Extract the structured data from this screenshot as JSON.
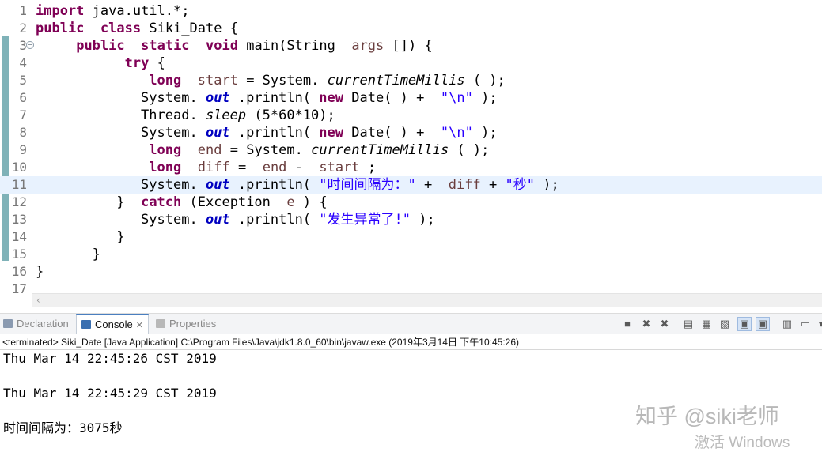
{
  "editor": {
    "current_line": "11",
    "lines": [
      {
        "n": "1",
        "tokens": [
          [
            "kw",
            "import"
          ],
          [
            "",
            "java.util.*;"
          ]
        ]
      },
      {
        "n": "2",
        "tokens": [
          [
            "kw",
            "public"
          ],
          [
            "",
            ""
          ],
          [
            "kw",
            "class"
          ],
          [
            "",
            "Siki_Date {"
          ]
        ]
      },
      {
        "n": "3",
        "fold": "−",
        "tokens": [
          [
            "",
            "    "
          ],
          [
            "kw",
            "public"
          ],
          [
            "",
            ""
          ],
          [
            "kw",
            "static"
          ],
          [
            "",
            ""
          ],
          [
            "kw",
            "void"
          ],
          [
            "",
            "main(String "
          ],
          [
            "var",
            "args"
          ],
          [
            "",
            "[]) {"
          ]
        ]
      },
      {
        "n": "4",
        "tokens": [
          [
            "",
            "          "
          ],
          [
            "kw",
            "try"
          ],
          [
            "",
            "{"
          ]
        ]
      },
      {
        "n": "5",
        "tokens": [
          [
            "",
            "             "
          ],
          [
            "kw",
            "long"
          ],
          [
            "",
            ""
          ],
          [
            "var",
            "start"
          ],
          [
            "",
            "= System."
          ],
          [
            "st",
            "currentTimeMillis"
          ],
          [
            "",
            "( );"
          ]
        ]
      },
      {
        "n": "6",
        "tokens": [
          [
            "",
            "             System."
          ],
          [
            "fld",
            "out"
          ],
          [
            "",
            ".println("
          ],
          [
            "kw",
            "new"
          ],
          [
            "",
            "Date( ) + "
          ],
          [
            "str",
            "\"\\n\""
          ],
          [
            "",
            ");"
          ]
        ]
      },
      {
        "n": "7",
        "tokens": [
          [
            "",
            "             Thread."
          ],
          [
            "st",
            "sleep"
          ],
          [
            "",
            "(5*60*10);"
          ]
        ]
      },
      {
        "n": "8",
        "tokens": [
          [
            "",
            "             System."
          ],
          [
            "fld",
            "out"
          ],
          [
            "",
            ".println("
          ],
          [
            "kw",
            "new"
          ],
          [
            "",
            "Date( ) + "
          ],
          [
            "str",
            "\"\\n\""
          ],
          [
            "",
            ");"
          ]
        ]
      },
      {
        "n": "9",
        "tokens": [
          [
            "",
            "             "
          ],
          [
            "kw",
            "long"
          ],
          [
            "",
            ""
          ],
          [
            "var",
            "end"
          ],
          [
            "",
            "= System."
          ],
          [
            "st",
            "currentTimeMillis"
          ],
          [
            "",
            "( );"
          ]
        ]
      },
      {
        "n": "10",
        "tokens": [
          [
            "",
            "             "
          ],
          [
            "kw",
            "long"
          ],
          [
            "",
            ""
          ],
          [
            "var",
            "diff"
          ],
          [
            "",
            "= "
          ],
          [
            "var",
            "end"
          ],
          [
            "",
            "- "
          ],
          [
            "var",
            "start"
          ],
          [
            "",
            ";"
          ]
        ]
      },
      {
        "n": "11",
        "tokens": [
          [
            "",
            "             System."
          ],
          [
            "fld",
            "out"
          ],
          [
            "",
            ".println("
          ],
          [
            "str",
            "\"时间间隔为：\""
          ],
          [
            "",
            "+ "
          ],
          [
            "var",
            "diff"
          ],
          [
            "",
            "+"
          ],
          [
            "str",
            "\"秒\""
          ],
          [
            "",
            ");"
          ]
        ]
      },
      {
        "n": "12",
        "tokens": [
          [
            "",
            "          } "
          ],
          [
            "kw",
            "catch"
          ],
          [
            "",
            "(Exception "
          ],
          [
            "var",
            "e"
          ],
          [
            "",
            ") {"
          ]
        ]
      },
      {
        "n": "13",
        "tokens": [
          [
            "",
            "             System."
          ],
          [
            "fld",
            "out"
          ],
          [
            "",
            ".println("
          ],
          [
            "str",
            "\"发生异常了!\""
          ],
          [
            "",
            ");"
          ]
        ]
      },
      {
        "n": "14",
        "tokens": [
          [
            "",
            "          }"
          ]
        ]
      },
      {
        "n": "15",
        "tokens": [
          [
            "",
            "       }"
          ]
        ]
      },
      {
        "n": "16",
        "tokens": [
          [
            "",
            "}"
          ]
        ]
      },
      {
        "n": "17",
        "tokens": []
      }
    ]
  },
  "tabs": [
    {
      "label": "Declaration",
      "icon_color": "#8a9ab0",
      "active": false
    },
    {
      "label": "Console",
      "icon_color": "#3a6fb0",
      "active": true,
      "close": "✕"
    },
    {
      "label": "Properties",
      "icon_color": "#b8b8b8",
      "active": false
    }
  ],
  "toolbar_icons": [
    "terminate-icon",
    "remove-launch-icon",
    "remove-all-terminated-icon",
    "clear-console-icon",
    "scroll-lock-icon",
    "word-wrap-icon",
    "show-on-stdout-icon",
    "show-on-stderr-icon",
    "pin-console-icon",
    "open-console-icon",
    "view-menu-icon"
  ],
  "toolbar_glyphs": [
    "■",
    "✖",
    "✖",
    "▤",
    "▦",
    "▧",
    "▣",
    "▣",
    "▥",
    "▭",
    "▾"
  ],
  "console": {
    "status": "<terminated> Siki_Date [Java Application] C:\\Program Files\\Java\\jdk1.8.0_60\\bin\\javaw.exe (2019年3月14日 下午10:45:26)",
    "output": [
      "Thu Mar 14 22:45:26 CST 2019",
      "",
      "Thu Mar 14 22:45:29 CST 2019",
      "",
      "时间间隔为：3075秒"
    ]
  },
  "watermark": "知乎 @siki老师",
  "os_overlay": "激活 Windows"
}
